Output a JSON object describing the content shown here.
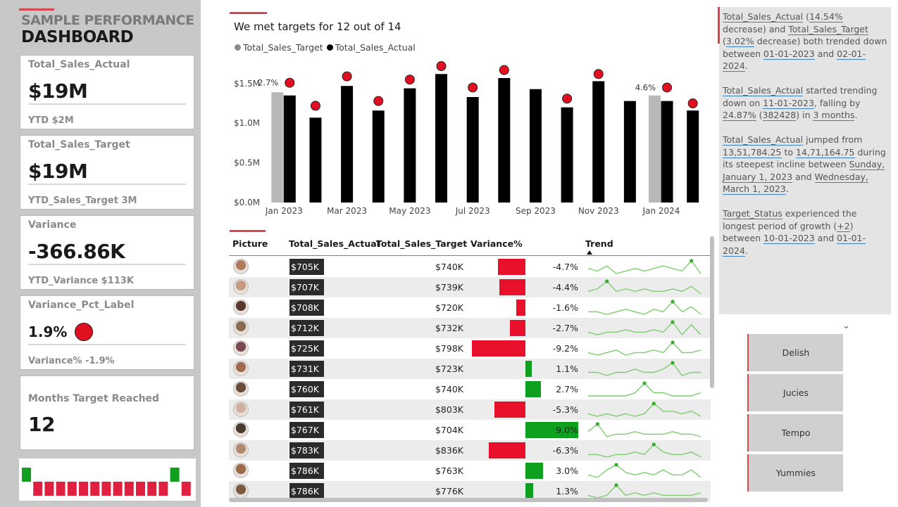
{
  "dashboard": {
    "title_line1": "SAMPLE PERFORMANCE",
    "title_line2": "DASHBOARD"
  },
  "cards": [
    {
      "label": "Total_Sales_Actual",
      "value": "$19M",
      "sub": "YTD $2M"
    },
    {
      "label": "Total_Sales_Target",
      "value": "$19M",
      "sub": "YTD_Sales_Target 3M"
    },
    {
      "label": "Variance",
      "value": "-366.86K",
      "sub": "YTD_Variance $113K"
    },
    {
      "label": "Variance_Pct_Label",
      "value": "1.9%",
      "sub": "Variance% -1.9%"
    },
    {
      "label": "Months Target Reached",
      "value": "12"
    }
  ],
  "mini_strip": {
    "values": [
      1,
      -1,
      -1,
      -1,
      -1,
      -1,
      -1,
      -1,
      -1,
      -1,
      -1,
      -1,
      -1,
      1,
      -1
    ],
    "colors": {
      "up": "#10a020",
      "down": "#e02040"
    }
  },
  "chart": {
    "title": "We met targets for 12 out of 14",
    "legend": [
      {
        "name": "Total_Sales_Target",
        "color": "#8a8a8a"
      },
      {
        "name": "Total_Sales_Actual",
        "color": "#000000"
      }
    ]
  },
  "chart_data": {
    "type": "bar",
    "title": "We met targets for 12 out of 14",
    "ylim": [
      0,
      1.8
    ],
    "y_ticks": [
      "$0.0M",
      "$0.5M",
      "$1.0M",
      "$1.5M"
    ],
    "y_tick_values": [
      0,
      0.5,
      1.0,
      1.5
    ],
    "x_tick_labels": [
      "Jan 2023",
      "Mar 2023",
      "May 2023",
      "Jul 2023",
      "Sep 2023",
      "Nov 2023",
      "Jan 2024"
    ],
    "x_tick_indices": [
      0,
      2,
      4,
      6,
      8,
      10,
      12
    ],
    "series": [
      {
        "name": "Total_Sales_Actual",
        "values": [
          1.35,
          1.07,
          1.47,
          1.16,
          1.44,
          1.62,
          1.33,
          1.57,
          1.43,
          1.2,
          1.53,
          1.28,
          1.28,
          1.16
        ]
      },
      {
        "name": "Total_Sales_Target",
        "values": [
          1.39,
          null,
          null,
          null,
          null,
          null,
          null,
          null,
          null,
          null,
          null,
          null,
          1.35,
          null
        ]
      }
    ],
    "markers": [
      1.51,
      1.22,
      1.59,
      1.28,
      1.55,
      1.72,
      1.45,
      1.67,
      null,
      1.31,
      1.62,
      null,
      1.45,
      1.25
    ],
    "annotations": [
      {
        "index": 0,
        "text": "2.7%"
      },
      {
        "index": 12,
        "text": "4.6%"
      }
    ],
    "colors": {
      "actual": "#000000",
      "target": "#b8b8b8",
      "marker": "#e01020"
    }
  },
  "table": {
    "headers": [
      "Picture",
      "Total_Sales_Actual",
      "Total_Sales_Target",
      "Variance%",
      "Trend"
    ],
    "rows": [
      {
        "actual": "$705K",
        "target": "$740K",
        "variance": -4.7,
        "variance_label": "-4.7%",
        "trend": [
          5,
          4,
          6,
          3,
          4,
          5,
          4,
          5,
          6,
          5,
          4,
          8,
          3
        ]
      },
      {
        "actual": "$707K",
        "target": "$739K",
        "variance": -4.4,
        "variance_label": "-4.4%",
        "trend": [
          4,
          5,
          8,
          4,
          5,
          4,
          5,
          4,
          4,
          5,
          4,
          6,
          3
        ]
      },
      {
        "actual": "$708K",
        "target": "$720K",
        "variance": -1.6,
        "variance_label": "-1.6%",
        "trend": [
          4,
          4,
          3,
          4,
          5,
          4,
          3,
          5,
          4,
          8,
          4,
          6,
          3
        ]
      },
      {
        "actual": "$712K",
        "target": "$732K",
        "variance": -2.7,
        "variance_label": "-2.7%",
        "trend": [
          4,
          3,
          4,
          4,
          5,
          4,
          4,
          5,
          4,
          8,
          3,
          7,
          3
        ]
      },
      {
        "actual": "$725K",
        "target": "$798K",
        "variance": -9.2,
        "variance_label": "-9.2%",
        "trend": [
          4,
          3,
          4,
          5,
          3,
          4,
          4,
          5,
          4,
          8,
          4,
          4,
          5
        ]
      },
      {
        "actual": "$731K",
        "target": "$723K",
        "variance": 1.1,
        "variance_label": "1.1%",
        "trend": [
          4,
          4,
          3,
          4,
          4,
          5,
          4,
          4,
          5,
          7,
          3,
          4,
          4
        ]
      },
      {
        "actual": "$760K",
        "target": "$740K",
        "variance": 2.7,
        "variance_label": "2.7%",
        "trend": [
          4,
          4,
          4,
          4,
          4,
          5,
          8,
          5,
          5,
          4,
          4,
          4,
          5
        ]
      },
      {
        "actual": "$761K",
        "target": "$803K",
        "variance": -5.3,
        "variance_label": "-5.3%",
        "trend": [
          4,
          3,
          4,
          3,
          4,
          3,
          4,
          8,
          5,
          5,
          4,
          5,
          3
        ]
      },
      {
        "actual": "$767K",
        "target": "$704K",
        "variance": 9.0,
        "variance_label": "9.0%",
        "trend": [
          5,
          8,
          3,
          4,
          4,
          5,
          4,
          4,
          4,
          5,
          4,
          4,
          3
        ]
      },
      {
        "actual": "$783K",
        "target": "$836K",
        "variance": -6.3,
        "variance_label": "-6.3%",
        "trend": [
          4,
          4,
          3,
          4,
          4,
          5,
          4,
          8,
          5,
          4,
          4,
          5,
          3
        ]
      },
      {
        "actual": "$786K",
        "target": "$763K",
        "variance": 3.0,
        "variance_label": "3.0%",
        "trend": [
          4,
          3,
          6,
          8,
          5,
          4,
          5,
          4,
          6,
          4,
          4,
          6,
          3
        ]
      },
      {
        "actual": "$786K",
        "target": "$776K",
        "variance": 1.3,
        "variance_label": "1.3%",
        "trend": [
          4,
          3,
          4,
          8,
          4,
          5,
          4,
          5,
          4,
          4,
          4,
          4,
          5
        ]
      }
    ]
  },
  "insights": {
    "p1": [
      "Total_Sales_Actual",
      " (",
      "14.54%",
      " decrease) and ",
      "Total_Sales_Target",
      " (",
      "3.02%",
      " decrease) both trended down between ",
      "01-01-2023",
      " and ",
      "02-01-2024",
      "."
    ],
    "p2": [
      "Total_Sales_Actual",
      " started trending down on ",
      "11-01-2023",
      ", falling by ",
      "24.87%",
      " (",
      "382428",
      ") in ",
      "3 months",
      "."
    ],
    "p3": [
      "Total_Sales_Actual",
      " jumped from ",
      "13,51,784.25",
      " to ",
      "14,71,164.75",
      " during its steepest incline between ",
      "Sunday, January 1, 2023",
      " and ",
      "Wednesday, March 1, 2023",
      "."
    ],
    "p4": [
      "Target_Status",
      " experienced the longest period of growth (",
      "+2",
      ") between ",
      "10-01-2023",
      " and ",
      "01-01-2024",
      "."
    ]
  },
  "slicer": {
    "items": [
      "Delish",
      "Jucies",
      "Tempo",
      "Yummies"
    ]
  }
}
